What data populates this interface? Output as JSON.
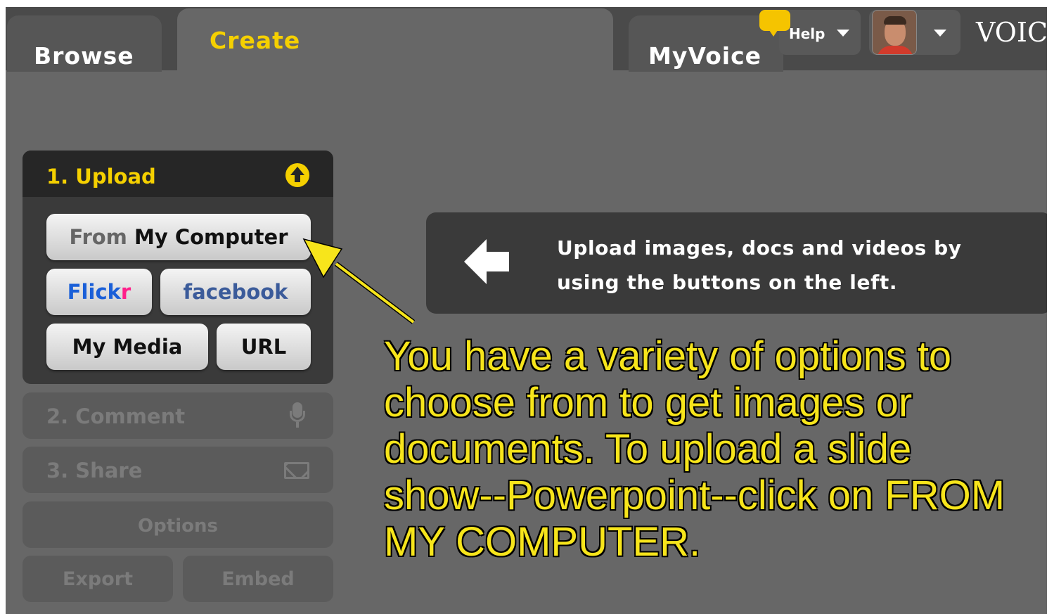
{
  "tabs": {
    "browse": "Browse",
    "create": "Create",
    "myvoice": "MyVoice"
  },
  "header": {
    "help_label": "Help",
    "brand": "VOICE"
  },
  "steps": {
    "upload": {
      "label": "1. Upload",
      "buttons": {
        "from_my_computer": {
          "prefix": "From",
          "rest": " My Computer"
        },
        "flickr": {
          "part1": "Flick",
          "part2": "r"
        },
        "facebook": "facebook",
        "my_media": "My Media",
        "url": "URL"
      }
    },
    "comment": {
      "label": "2. Comment"
    },
    "share": {
      "label": "3. Share"
    },
    "options": "Options",
    "export": "Export",
    "embed": "Embed"
  },
  "info": {
    "text": "Upload images, docs and videos by using the buttons on the left."
  },
  "annotation": {
    "text": "You have a variety of options to choose from to get images or documents. To upload a slide show--Powerpoint--click on FROM MY COMPUTER."
  },
  "colors": {
    "accent": "#f5d000",
    "annotation": "#f7e51b",
    "flickr_blue": "#1a5fd8",
    "flickr_pink": "#ff1f8a",
    "facebook_blue": "#3b5b9a"
  },
  "icons": [
    "help-bubble-icon",
    "chevron-down-icon",
    "avatar",
    "upload-arrow-icon",
    "microphone-icon",
    "mail-icon",
    "left-arrow-icon"
  ]
}
